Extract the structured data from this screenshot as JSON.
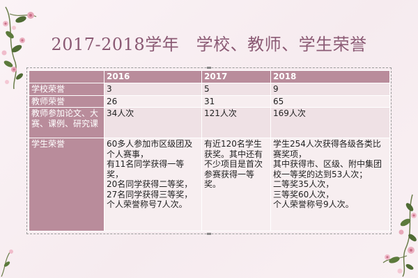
{
  "title": "2017-2018学年   学校、教师、学生荣誉",
  "table": {
    "headers": [
      "",
      "2016",
      "2017",
      "2018"
    ],
    "rows": [
      {
        "label": "学校荣誉",
        "values": [
          "3",
          "5",
          "9"
        ]
      },
      {
        "label": "教师荣誉",
        "values": [
          "26",
          "31",
          "65"
        ]
      },
      {
        "label": "教师参加论文、大赛、课例、研究课",
        "values": [
          "34人次",
          "121人次",
          "169人次"
        ]
      },
      {
        "label": "学生荣誉",
        "values": [
          "60多人参加市区级团及个人赛事，\n有11名同学获得一等奖，\n20名同学获得二等奖，\n27名同学获得三等奖，\n个人荣誉称号7人次。",
          "有近120名学生获奖。其中还有不少项目是首次参赛获得一等奖。",
          "学生254人次获得各级各类比赛奖项，\n其中获得市、区级、附中集团校一等奖的达到53人次；\n二等奖35人次，\n三等奖60人次，\n个人荣誉称号9人次。"
        ]
      }
    ]
  },
  "colors": {
    "header": "#b98c9b",
    "cell_light": "#efe1e5",
    "title": "#8b5a74"
  }
}
